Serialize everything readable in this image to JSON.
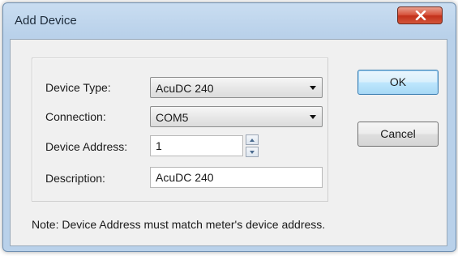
{
  "window": {
    "title": "Add Device"
  },
  "form": {
    "device_type": {
      "label": "Device Type:",
      "value": "AcuDC 240"
    },
    "connection": {
      "label": "Connection:",
      "value": "COM5"
    },
    "device_address": {
      "label": "Device Address:",
      "value": "1"
    },
    "description": {
      "label": "Description:",
      "value": "AcuDC 240"
    }
  },
  "buttons": {
    "ok_label": "OK",
    "cancel_label": "Cancel"
  },
  "note": "Note: Device Address must match meter's device address.",
  "colors": {
    "close_button": "#c2301a",
    "default_button_border": "#3c7fb1",
    "title_bar": "#b9d1ea"
  },
  "icons": {
    "close": "close-icon",
    "dropdown": "chevron-down-icon",
    "spin_up": "spin-up-icon",
    "spin_down": "spin-down-icon"
  }
}
